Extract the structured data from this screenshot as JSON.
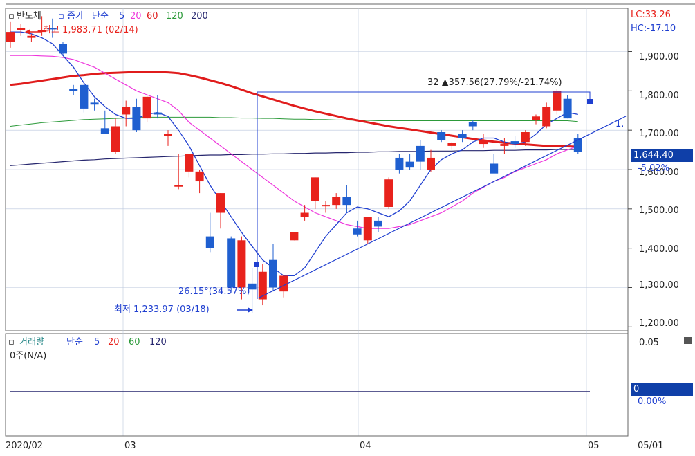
{
  "colors": {
    "up": "#e8221c",
    "down": "#1f5fd0",
    "ma5": "#1f3fd0",
    "ma20": "#ee35dc",
    "ma60": "#e01c1c",
    "ma120": "#2c9a3a",
    "ma200": "#26266e",
    "grid": "#b9c6dc",
    "axis": "#3a3a3a",
    "highlight": "#0f3fa8"
  },
  "header": {
    "symbol": "반도체",
    "price_label": "종가",
    "ma_label": "단순",
    "ma5": "5",
    "ma20": "20",
    "ma60": "60",
    "ma120": "120",
    "ma200": "200",
    "lc": "LC:33.26",
    "hc": "HC:-17.10"
  },
  "annotations": {
    "high": "최고 1,983.71 (02/14)",
    "low": "최저 1,233.97 (03/18)",
    "range": "32 ▲357.56(27.79%/-21.74%)",
    "pct": "26.15°(34.57%)",
    "trend_marker": "1."
  },
  "price_axis": {
    "ticks": [
      "1,900.00",
      "1,800.00",
      "1,700.00",
      "1,600.00",
      "1,500.00",
      "1,400.00",
      "1,300.00",
      "1,200.00"
    ],
    "current": "1,644.40",
    "change": "-5.02%"
  },
  "volume_panel": {
    "title": "거래량",
    "ma_label": "단순",
    "ma5": "5",
    "ma20": "20",
    "ma60": "60",
    "ma120": "120",
    "value": "0주(N/A)",
    "ticks": [
      "0.05"
    ],
    "current": "0",
    "change": "0.00%"
  },
  "x_axis": {
    "labels": [
      "2020/02",
      "03",
      "04",
      "05"
    ],
    "right": "05/01"
  },
  "chart_data": {
    "type": "candlestick",
    "y_range": [
      1190,
      2010
    ],
    "candles": [
      {
        "o": 1925,
        "h": 1975,
        "l": 1910,
        "c": 1950
      },
      {
        "o": 1955,
        "h": 1970,
        "l": 1940,
        "c": 1960
      },
      {
        "o": 1935,
        "h": 1945,
        "l": 1925,
        "c": 1940
      },
      {
        "o": 1950,
        "h": 1990,
        "l": 1940,
        "c": 1955
      },
      {
        "o": 1960,
        "h": 1984,
        "l": 1935,
        "c": 1958
      },
      {
        "o": 1920,
        "h": 1925,
        "l": 1890,
        "c": 1895
      },
      {
        "o": 1805,
        "h": 1815,
        "l": 1790,
        "c": 1800
      },
      {
        "o": 1815,
        "h": 1820,
        "l": 1745,
        "c": 1755
      },
      {
        "o": 1770,
        "h": 1780,
        "l": 1750,
        "c": 1765
      },
      {
        "o": 1705,
        "h": 1750,
        "l": 1690,
        "c": 1690
      },
      {
        "o": 1645,
        "h": 1730,
        "l": 1640,
        "c": 1710
      },
      {
        "o": 1740,
        "h": 1775,
        "l": 1710,
        "c": 1760
      },
      {
        "o": 1760,
        "h": 1780,
        "l": 1695,
        "c": 1700
      },
      {
        "o": 1730,
        "h": 1790,
        "l": 1720,
        "c": 1785
      },
      {
        "o": 1745,
        "h": 1790,
        "l": 1730,
        "c": 1740
      },
      {
        "o": 1685,
        "h": 1700,
        "l": 1660,
        "c": 1690
      },
      {
        "o": 1560,
        "h": 1640,
        "l": 1550,
        "c": 1560
      },
      {
        "o": 1595,
        "h": 1640,
        "l": 1580,
        "c": 1640
      },
      {
        "o": 1570,
        "h": 1600,
        "l": 1540,
        "c": 1595
      },
      {
        "o": 1430,
        "h": 1490,
        "l": 1390,
        "c": 1400
      },
      {
        "o": 1490,
        "h": 1540,
        "l": 1450,
        "c": 1540
      },
      {
        "o": 1425,
        "h": 1430,
        "l": 1290,
        "c": 1300
      },
      {
        "o": 1300,
        "h": 1430,
        "l": 1270,
        "c": 1420
      },
      {
        "o": 1310,
        "h": 1350,
        "l": 1234,
        "c": 1295
      },
      {
        "o": 1270,
        "h": 1360,
        "l": 1255,
        "c": 1340
      },
      {
        "o": 1370,
        "h": 1410,
        "l": 1290,
        "c": 1300
      },
      {
        "o": 1290,
        "h": 1330,
        "l": 1275,
        "c": 1330
      },
      {
        "o": 1420,
        "h": 1440,
        "l": 1420,
        "c": 1440
      },
      {
        "o": 1480,
        "h": 1510,
        "l": 1470,
        "c": 1490
      },
      {
        "o": 1520,
        "h": 1580,
        "l": 1500,
        "c": 1580
      },
      {
        "o": 1510,
        "h": 1520,
        "l": 1490,
        "c": 1510
      },
      {
        "o": 1510,
        "h": 1540,
        "l": 1500,
        "c": 1530
      },
      {
        "o": 1530,
        "h": 1560,
        "l": 1490,
        "c": 1510
      },
      {
        "o": 1450,
        "h": 1470,
        "l": 1430,
        "c": 1435
      },
      {
        "o": 1420,
        "h": 1480,
        "l": 1410,
        "c": 1480
      },
      {
        "o": 1470,
        "h": 1480,
        "l": 1440,
        "c": 1455
      },
      {
        "o": 1505,
        "h": 1580,
        "l": 1500,
        "c": 1575
      },
      {
        "o": 1630,
        "h": 1640,
        "l": 1590,
        "c": 1600
      },
      {
        "o": 1620,
        "h": 1640,
        "l": 1600,
        "c": 1605
      },
      {
        "o": 1660,
        "h": 1675,
        "l": 1600,
        "c": 1620
      },
      {
        "o": 1600,
        "h": 1650,
        "l": 1595,
        "c": 1630
      },
      {
        "o": 1695,
        "h": 1700,
        "l": 1670,
        "c": 1675
      },
      {
        "o": 1660,
        "h": 1670,
        "l": 1650,
        "c": 1668
      },
      {
        "o": 1690,
        "h": 1700,
        "l": 1670,
        "c": 1680
      },
      {
        "o": 1720,
        "h": 1725,
        "l": 1700,
        "c": 1710
      },
      {
        "o": 1665,
        "h": 1690,
        "l": 1655,
        "c": 1675
      },
      {
        "o": 1615,
        "h": 1640,
        "l": 1600,
        "c": 1590
      },
      {
        "o": 1660,
        "h": 1680,
        "l": 1640,
        "c": 1665
      },
      {
        "o": 1672,
        "h": 1685,
        "l": 1655,
        "c": 1665
      },
      {
        "o": 1670,
        "h": 1700,
        "l": 1660,
        "c": 1695
      },
      {
        "o": 1725,
        "h": 1740,
        "l": 1715,
        "c": 1735
      },
      {
        "o": 1710,
        "h": 1770,
        "l": 1705,
        "c": 1760
      },
      {
        "o": 1750,
        "h": 1805,
        "l": 1740,
        "c": 1800
      },
      {
        "o": 1780,
        "h": 1790,
        "l": 1730,
        "c": 1730
      },
      {
        "o": 1680,
        "h": 1690,
        "l": 1640,
        "c": 1644
      }
    ],
    "ma5": [
      1950,
      1950,
      1945,
      1935,
      1920,
      1890,
      1860,
      1820,
      1785,
      1760,
      1740,
      1730,
      1730,
      1740,
      1745,
      1735,
      1700,
      1660,
      1610,
      1560,
      1520,
      1480,
      1440,
      1405,
      1370,
      1350,
      1330,
      1330,
      1350,
      1390,
      1430,
      1460,
      1490,
      1505,
      1500,
      1490,
      1480,
      1495,
      1520,
      1560,
      1600,
      1625,
      1640,
      1650,
      1670,
      1680,
      1680,
      1670,
      1665,
      1670,
      1690,
      1715,
      1730,
      1745,
      1740
    ],
    "ma20": [
      1890,
      1890,
      1890,
      1889,
      1888,
      1885,
      1880,
      1870,
      1860,
      1845,
      1830,
      1815,
      1800,
      1790,
      1780,
      1770,
      1750,
      1720,
      1700,
      1680,
      1660,
      1640,
      1620,
      1600,
      1580,
      1560,
      1540,
      1520,
      1505,
      1490,
      1480,
      1470,
      1460,
      1455,
      1450,
      1450,
      1450,
      1455,
      1460,
      1470,
      1480,
      1490,
      1505,
      1520,
      1540,
      1555,
      1570,
      1580,
      1595,
      1605,
      1615,
      1625,
      1640,
      1650,
      1660
    ],
    "ma60": [
      1815,
      1818,
      1822,
      1826,
      1830,
      1834,
      1838,
      1840,
      1843,
      1845,
      1846,
      1847,
      1848,
      1848,
      1848,
      1847,
      1845,
      1840,
      1834,
      1827,
      1820,
      1812,
      1803,
      1794,
      1786,
      1778,
      1770,
      1762,
      1755,
      1748,
      1742,
      1736,
      1730,
      1725,
      1720,
      1715,
      1710,
      1706,
      1702,
      1698,
      1694,
      1690,
      1686,
      1682,
      1678,
      1674,
      1671,
      1668,
      1666,
      1664,
      1662,
      1660,
      1659,
      1659,
      1658
    ],
    "ma120": [
      1710,
      1713,
      1716,
      1719,
      1721,
      1723,
      1725,
      1727,
      1728,
      1729,
      1730,
      1731,
      1732,
      1733,
      1733,
      1733,
      1733,
      1733,
      1733,
      1733,
      1732,
      1732,
      1731,
      1731,
      1730,
      1730,
      1729,
      1728,
      1728,
      1727,
      1727,
      1726,
      1726,
      1725,
      1725,
      1724,
      1724,
      1724,
      1724,
      1724,
      1724,
      1724,
      1724,
      1724,
      1724,
      1724,
      1724,
      1724,
      1724,
      1724,
      1724,
      1724,
      1724,
      1724,
      1722
    ],
    "ma200": [
      1610,
      1612,
      1614,
      1616,
      1618,
      1620,
      1622,
      1624,
      1625,
      1627,
      1628,
      1629,
      1630,
      1631,
      1632,
      1633,
      1634,
      1635,
      1636,
      1637,
      1637,
      1638,
      1638,
      1639,
      1639,
      1640,
      1640,
      1641,
      1641,
      1642,
      1642,
      1643,
      1643,
      1644,
      1644,
      1645,
      1645,
      1646,
      1646,
      1646,
      1647,
      1647,
      1647,
      1648,
      1648,
      1648,
      1649,
      1649,
      1649,
      1650,
      1650,
      1650,
      1651,
      1651,
      1651
    ]
  }
}
